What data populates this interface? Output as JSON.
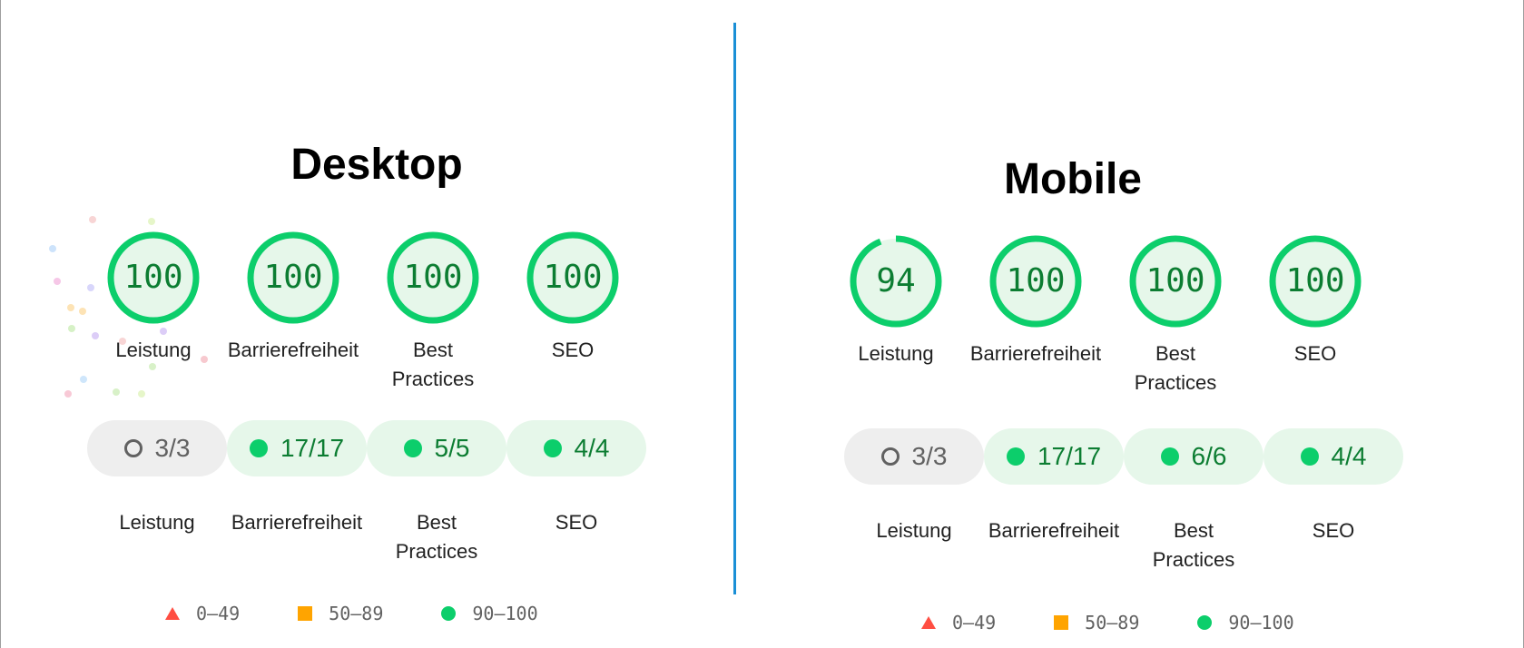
{
  "colors": {
    "pass": "#0cce6b",
    "pass_text": "#0c7d32",
    "pass_bg": "#e6f7ea",
    "average": "#ffa400",
    "fail": "#ff4e42",
    "neutral": "#616161",
    "neutral_bg": "#eeeeee",
    "divider": "#1a8fd6"
  },
  "desktop": {
    "title": "Desktop",
    "gauges": [
      {
        "score": "100",
        "value": 100,
        "label_lines": [
          "Leistung"
        ]
      },
      {
        "score": "100",
        "value": 100,
        "label_lines": [
          "Barrierefreiheit"
        ]
      },
      {
        "score": "100",
        "value": 100,
        "label_lines": [
          "Best",
          "Practices"
        ]
      },
      {
        "score": "100",
        "value": 100,
        "label_lines": [
          "SEO"
        ]
      }
    ],
    "pills": [
      {
        "text": "3/3",
        "status": "neutral"
      },
      {
        "text": "17/17",
        "status": "pass"
      },
      {
        "text": "5/5",
        "status": "pass"
      },
      {
        "text": "4/4",
        "status": "pass"
      }
    ],
    "category_labels": [
      [
        "Leistung"
      ],
      [
        "Barrierefreiheit"
      ],
      [
        "Best",
        "Practices"
      ],
      [
        "SEO"
      ]
    ]
  },
  "mobile": {
    "title": "Mobile",
    "gauges": [
      {
        "score": "94",
        "value": 94,
        "label_lines": [
          "Leistung"
        ]
      },
      {
        "score": "100",
        "value": 100,
        "label_lines": [
          "Barrierefreiheit"
        ]
      },
      {
        "score": "100",
        "value": 100,
        "label_lines": [
          "Best",
          "Practices"
        ]
      },
      {
        "score": "100",
        "value": 100,
        "label_lines": [
          "SEO"
        ]
      }
    ],
    "pills": [
      {
        "text": "3/3",
        "status": "neutral"
      },
      {
        "text": "17/17",
        "status": "pass"
      },
      {
        "text": "6/6",
        "status": "pass"
      },
      {
        "text": "4/4",
        "status": "pass"
      }
    ],
    "category_labels": [
      [
        "Leistung"
      ],
      [
        "Barrierefreiheit"
      ],
      [
        "Best",
        "Practices"
      ],
      [
        "SEO"
      ]
    ]
  },
  "legend": {
    "fail_range": "0–49",
    "average_range": "50–89",
    "pass_range": "90–100",
    "fail_icon": "triangle-icon",
    "average_icon": "square-icon",
    "pass_icon": "circle-icon"
  }
}
